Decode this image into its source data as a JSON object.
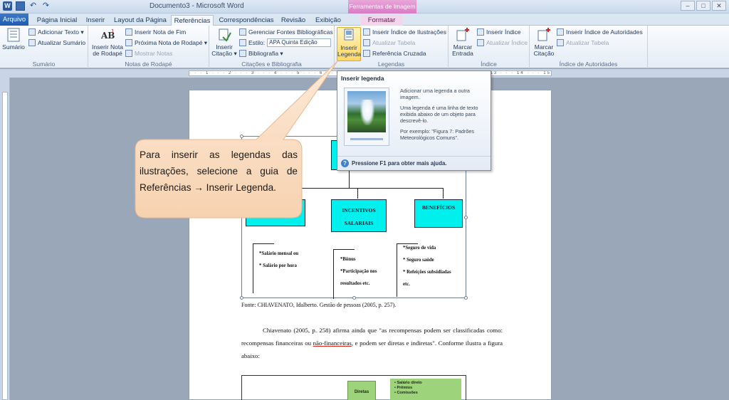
{
  "window": {
    "title": "Documento3 - Microsoft Word",
    "context_group": "Ferramentas de Imagem",
    "minimize": "–",
    "maximize": "□",
    "close": "✕"
  },
  "tabs": [
    "Arquivo",
    "Página Inicial",
    "Inserir",
    "Layout da Página",
    "Referências",
    "Correspondências",
    "Revisão",
    "Exibição",
    "Formatar"
  ],
  "ribbon": {
    "sumario": {
      "big": "Sumário",
      "add_text": "Adicionar Texto ▾",
      "update": "Atualizar Sumário",
      "label": "Sumário"
    },
    "notas": {
      "big_line1": "Inserir Nota",
      "big_line2": "de Rodapé",
      "end_note": "Inserir Nota de Fim",
      "next_note": "Próxima Nota de Rodapé ▾",
      "show_notes": "Mostrar Notas",
      "label": "Notas de Rodapé"
    },
    "citacoes": {
      "big_line1": "Inserir",
      "big_line2": "Citação ▾",
      "manage": "Gerenciar Fontes Bibliográficas",
      "style_label": "Estilo:",
      "style_value": "APA Quinta Edição",
      "biblio": "Bibliografia ▾",
      "label": "Citações e Bibliografia"
    },
    "legendas": {
      "big_line1": "Inserir",
      "big_line2": "Legenda",
      "illus_index": "Inserir Índice de Ilustrações",
      "update_table": "Atualizar Tabela",
      "cross_ref": "Referência Cruzada",
      "label": "Legendas"
    },
    "indice": {
      "big_line1": "Marcar",
      "big_line2": "Entrada",
      "insert": "Inserir Índice",
      "update": "Atualizar Índice",
      "label": "Índice"
    },
    "autoridades": {
      "big_line1": "Marcar",
      "big_line2": "Citação",
      "insert": "Inserir Índice de Autoridades",
      "update": "Atualizar Tabela",
      "label": "Índice de Autoridades"
    }
  },
  "tooltip": {
    "title": "Inserir legenda",
    "p1": "Adicionar uma legenda a outra imagem.",
    "p2": "Uma legenda é uma linha de texto exibida abaixo de um objeto para descrevê-lo.",
    "p3": "Por exemplo: \"Figura 7: Padrões Meteorológicos Comuns\".",
    "help": "Pressione F1 para obter mais ajuda."
  },
  "callout": "Para inserir as legendas das ilustrações, selecione a guia de Referências → Inserir Legenda.",
  "document": {
    "box_incentivos_1": "INCENTIVOS",
    "box_incentivos_2": "SALARIAIS",
    "box_beneficios": "BENEFÍCIOS",
    "col1": [
      "*Salário mensal ou",
      "* Salário por hora"
    ],
    "col2": [
      "*Bônus",
      "*Participação nos",
      "resultados etc."
    ],
    "col3": [
      "*Seguro de vida",
      "* Seguro saúde",
      "* Refeições subsidiadas",
      "etc."
    ],
    "source": "Fonte: CHIAVENATO, Idalberto. Gestão de pessoas (2005, p. 257).",
    "para_a": "Chiavenato (2005, p. 258) afirma ainda que \"as recompensas podem ser classificadas como: recompensas financeiras ou ",
    "para_u": "não-financeiras",
    "para_b": ", e podem ser diretas e indiretas\". Conforme ilustra a figura abaixo:",
    "fig2_box": "Diretas",
    "fig2_items": [
      "• Salário direto",
      "• Prêmios",
      "• Comissões"
    ]
  }
}
